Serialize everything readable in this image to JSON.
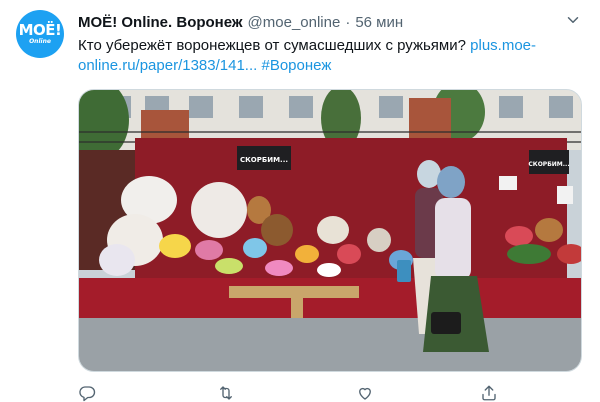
{
  "author": {
    "name": "МОЁ! Online. Воронеж",
    "handle": "@moe_online",
    "separator": "·",
    "time": "56 мин",
    "avatar": {
      "line1": "МОЁ!",
      "line2": "Online",
      "bg": "#1da1f2"
    }
  },
  "tweet": {
    "text": "Кто убережёт воронежцев от сумасшедших с ружьями? ",
    "link": "plus.moe-online.ru/paper/1383/141...",
    "hashtag": "#Воронеж"
  },
  "photo": {
    "sign_left": "СКОРБИМ...",
    "sign_right": "СКОРБИМ..."
  },
  "icons": {
    "more": "more-options-icon",
    "reply": "reply-icon",
    "retweet": "retweet-icon",
    "like": "like-icon",
    "share": "share-icon"
  },
  "colors": {
    "accent": "#1b95e0",
    "muted": "#536471",
    "text": "#0f1419"
  }
}
